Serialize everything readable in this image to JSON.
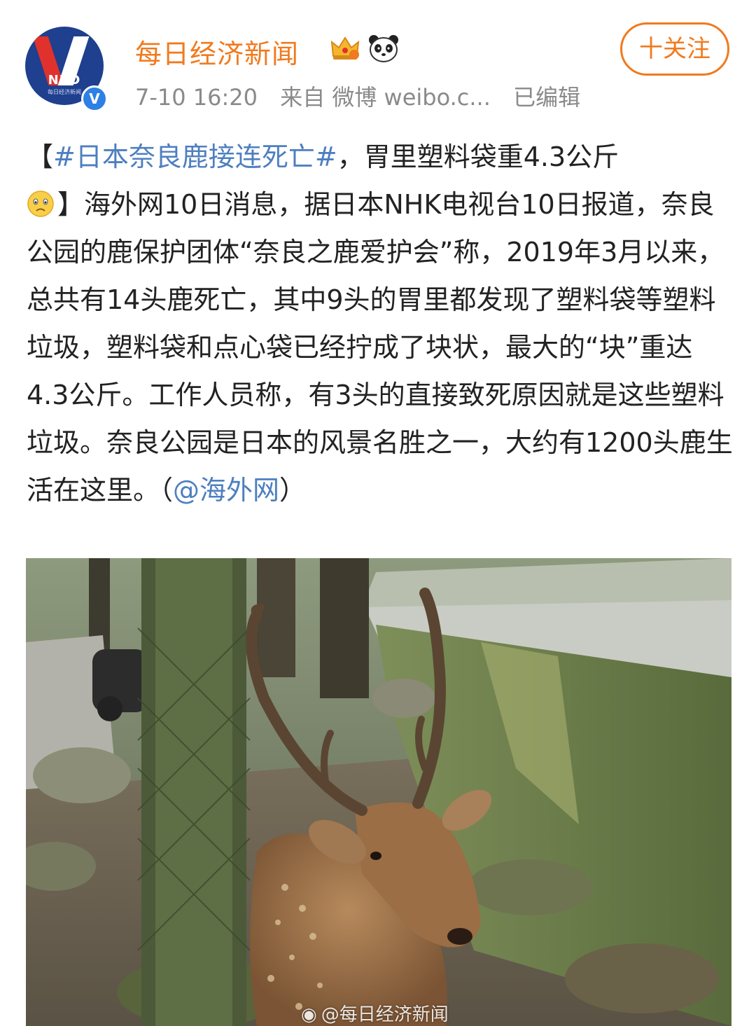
{
  "account": {
    "name": "每日经济新闻",
    "avatar_text": "NBD",
    "avatar_subtext": "每日经济新闻",
    "verified_mark": "V",
    "badges": [
      "crown-icon",
      "panda-icon"
    ]
  },
  "meta": {
    "time": "7-10 16:20",
    "source": "来自 微博 weibo.c...",
    "edited": "已编辑"
  },
  "follow_button": {
    "label": "十关注"
  },
  "post": {
    "open_bracket": "【",
    "topic": "#日本奈良鹿接连死亡#",
    "headline_rest": "，胃里塑料袋重4.3公斤",
    "emoji": "sad-face-icon",
    "body": "】海外网10日消息，据日本NHK电视台10日报道，奈良公园的鹿保护团体“奈良之鹿爱护会”称，2019年3月以来，总共有14头鹿死亡，其中9头的胃里都发现了塑料袋等塑料垃圾，塑料袋和点心袋已经拧成了块状，最大的“块”重达4.3公斤。工作人员称，有3头的直接致死原因就是这些塑料垃圾。奈良公园是日本的风景名胜之一，大约有1200头鹿生活在这里。（",
    "mention": "@海外网",
    "close": "）"
  },
  "image": {
    "description_icon": "deer-photo",
    "watermark": "@每日经济新闻"
  },
  "colors": {
    "accent": "#f07a1e",
    "link": "#4d7fc0",
    "meta": "#8a8a8a",
    "verified": "#2e80e4"
  }
}
